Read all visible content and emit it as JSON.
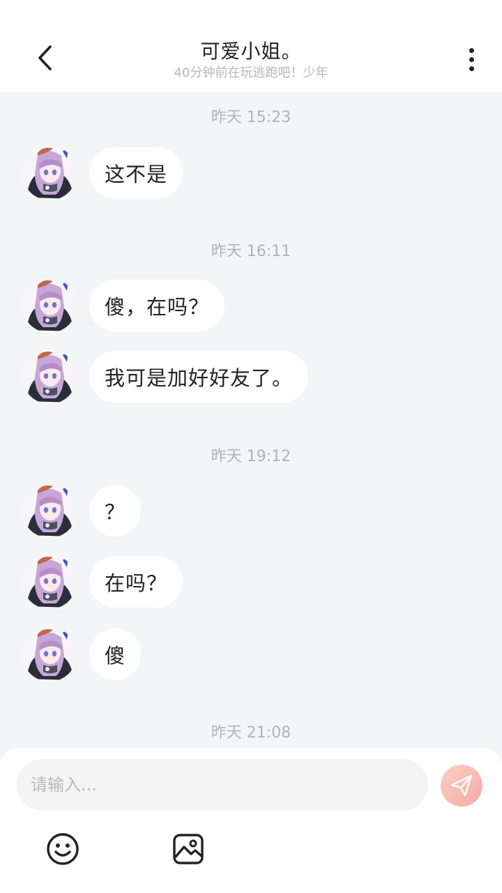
{
  "header": {
    "title": "可爱小姐。",
    "subtitle": "40分钟前在玩逃跑吧！少年"
  },
  "messages": {
    "t1": "昨天 15:23",
    "m1": "这不是",
    "t2": "昨天 16:11",
    "m2": "傻，在吗？",
    "m3": "我可是加好好友了。",
    "t3": "昨天 19:12",
    "m4": "？",
    "m5": "在吗？",
    "m6": "傻",
    "t4": "昨天 21:08"
  },
  "input": {
    "placeholder": "请输入..."
  },
  "icons": {
    "back": "chevron-left-icon",
    "more": "more-vertical-icon",
    "send": "paper-plane-icon",
    "emoji": "smiley-icon",
    "image": "image-icon"
  },
  "colors": {
    "background": "#f4f5f7",
    "bubble": "#ffffff",
    "send_button": "#f7a9a4",
    "timestamp": "#b3b3b3"
  }
}
